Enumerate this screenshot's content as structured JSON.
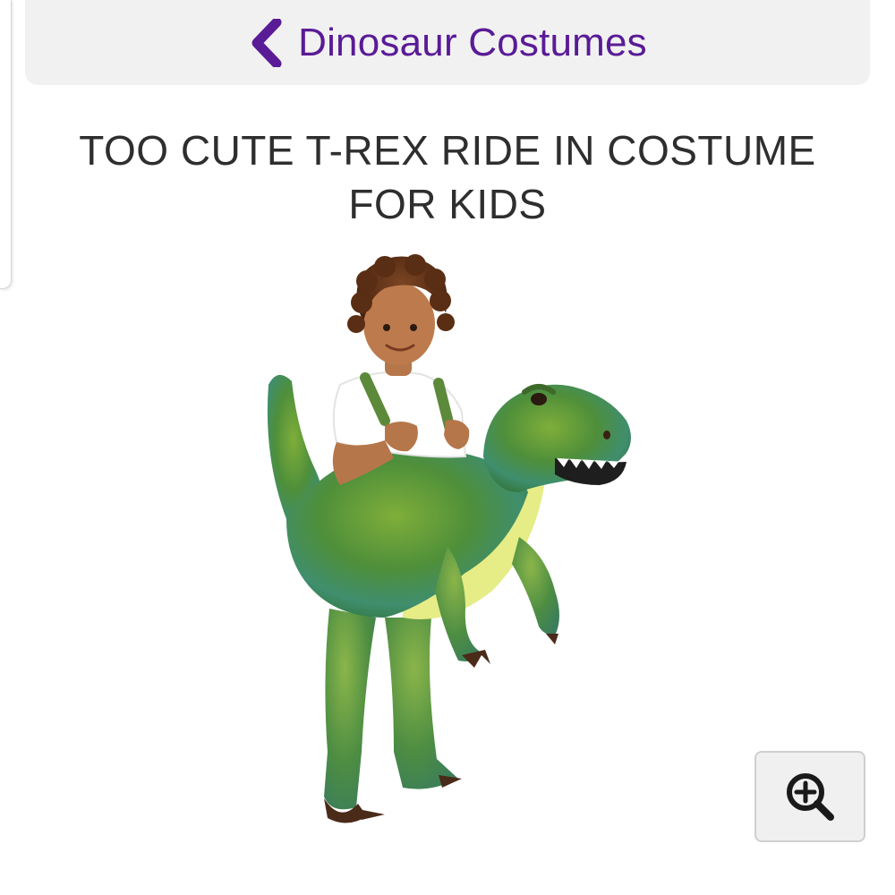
{
  "nav": {
    "back_label": "Dinosaur Costumes",
    "back_icon": "chevron-left-icon",
    "accent_color": "#5a1b96"
  },
  "product": {
    "title": "TOO CUTE T-REX RIDE IN COSTUME FOR KIDS",
    "image_alt": "Child wearing a green T-Rex ride-in costume"
  },
  "zoom": {
    "icon": "zoom-in-icon"
  }
}
